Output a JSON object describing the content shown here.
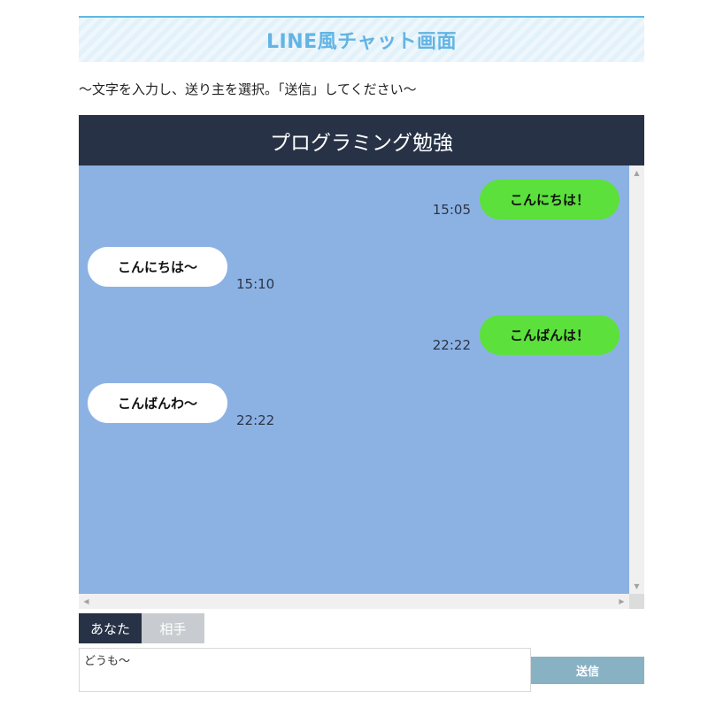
{
  "page": {
    "heading": "LINE風チャット画面",
    "instructions": "〜文字を入力し、送り主を選択。「送信」してください〜"
  },
  "chat": {
    "room_title": "プログラミング勉強",
    "messages": [
      {
        "sender": "you",
        "text": "こんにちは！",
        "time": "15:05"
      },
      {
        "sender": "partner",
        "text": "こんにちは〜",
        "time": "15:10"
      },
      {
        "sender": "you",
        "text": "こんばんは！",
        "time": "22:22"
      },
      {
        "sender": "partner",
        "text": "こんばんわ〜",
        "time": "22:22"
      }
    ]
  },
  "composer": {
    "tabs": [
      {
        "label": "あなた",
        "selected": true
      },
      {
        "label": "相手",
        "selected": false
      }
    ],
    "input_value": "どうも〜",
    "send_label": "送信"
  },
  "colors": {
    "header_bg": "#273246",
    "chat_bg": "#8cb2e4",
    "my_bubble": "#5ce03c",
    "partner_bubble": "#ffffff",
    "send_button": "#89b1c4",
    "heading_text": "#62b4e4"
  },
  "icons": {
    "scroll_up": "▲",
    "scroll_down": "▼",
    "scroll_left": "◀",
    "scroll_right": "▶"
  }
}
